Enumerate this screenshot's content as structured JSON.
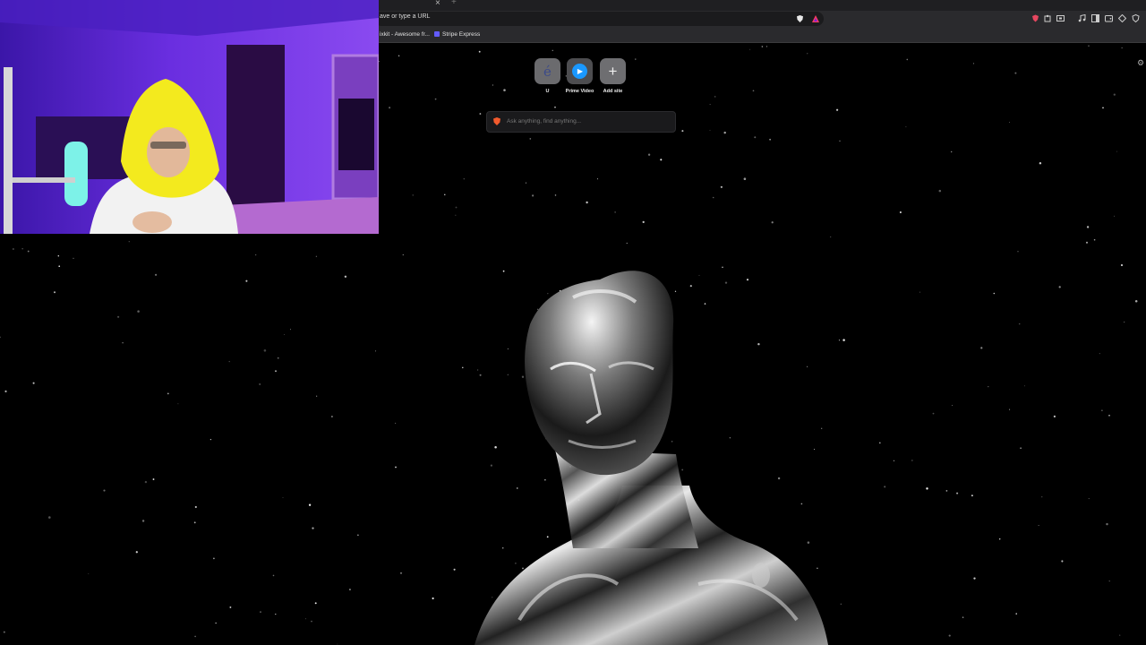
{
  "browser": {
    "tab": {
      "close_glyph": "×",
      "new_tab_glyph": "+"
    },
    "address_bar": {
      "placeholder": "ave or type a URL"
    },
    "toolbar_icons": [
      "brave-shields-icon",
      "brave-rewards-icon",
      "extension-icon",
      "puzzle-icon",
      "screenshot-icon",
      "music-icon",
      "sidebar-icon",
      "wallet-icon",
      "leo-icon",
      "vpn-icon"
    ],
    "bookmarks": [
      {
        "label": "ixkit - Awesome fr..."
      },
      {
        "label": "Stripe Express"
      }
    ]
  },
  "new_tab": {
    "settings_glyph": "⚙",
    "sites": [
      {
        "label": "U",
        "glyph": "é"
      },
      {
        "label": "Prime Video",
        "glyph": "▶"
      },
      {
        "label": "Add site",
        "glyph": "+"
      }
    ],
    "search": {
      "placeholder": "Ask anything, find anything..."
    }
  },
  "colors": {
    "background": "#000000",
    "toolbar": "#2a2a2d",
    "webcam_wall": "#6a2ee0",
    "costume": "#f3ea1e",
    "prime_blue": "#1a98ff"
  }
}
